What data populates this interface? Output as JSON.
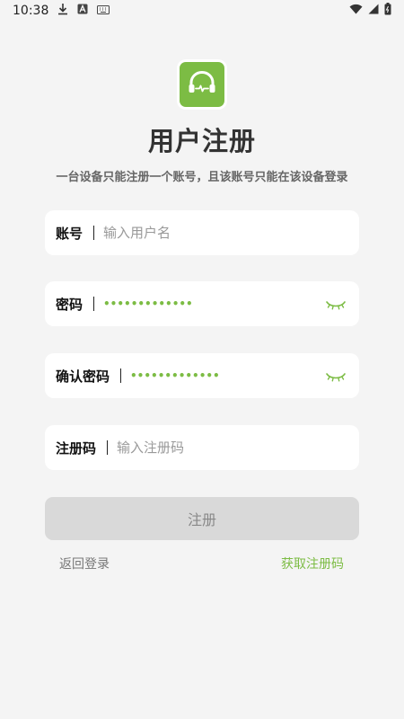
{
  "status_bar": {
    "time": "10:38",
    "left_icons": [
      "download-icon",
      "a-icon",
      "keyboard-icon"
    ],
    "right_icons": [
      "wifi-icon",
      "signal-icon",
      "battery-icon"
    ]
  },
  "header": {
    "title": "用户注册",
    "subtitle": "一台设备只能注册一个账号，且该账号只能在该设备登录"
  },
  "form": {
    "account": {
      "label": "账号",
      "placeholder": "输入用户名",
      "value": ""
    },
    "password": {
      "label": "密码",
      "masked": "•••••••••••••"
    },
    "confirm_password": {
      "label": "确认密码",
      "masked": "•••••••••••••"
    },
    "reg_code": {
      "label": "注册码",
      "placeholder": "输入注册码",
      "value": ""
    }
  },
  "actions": {
    "submit_label": "注册",
    "back_label": "返回登录",
    "get_code_label": "获取注册码"
  },
  "colors": {
    "accent": "#7cbc44",
    "background": "#f4f4f4",
    "button_disabled": "#d9d9d9"
  }
}
